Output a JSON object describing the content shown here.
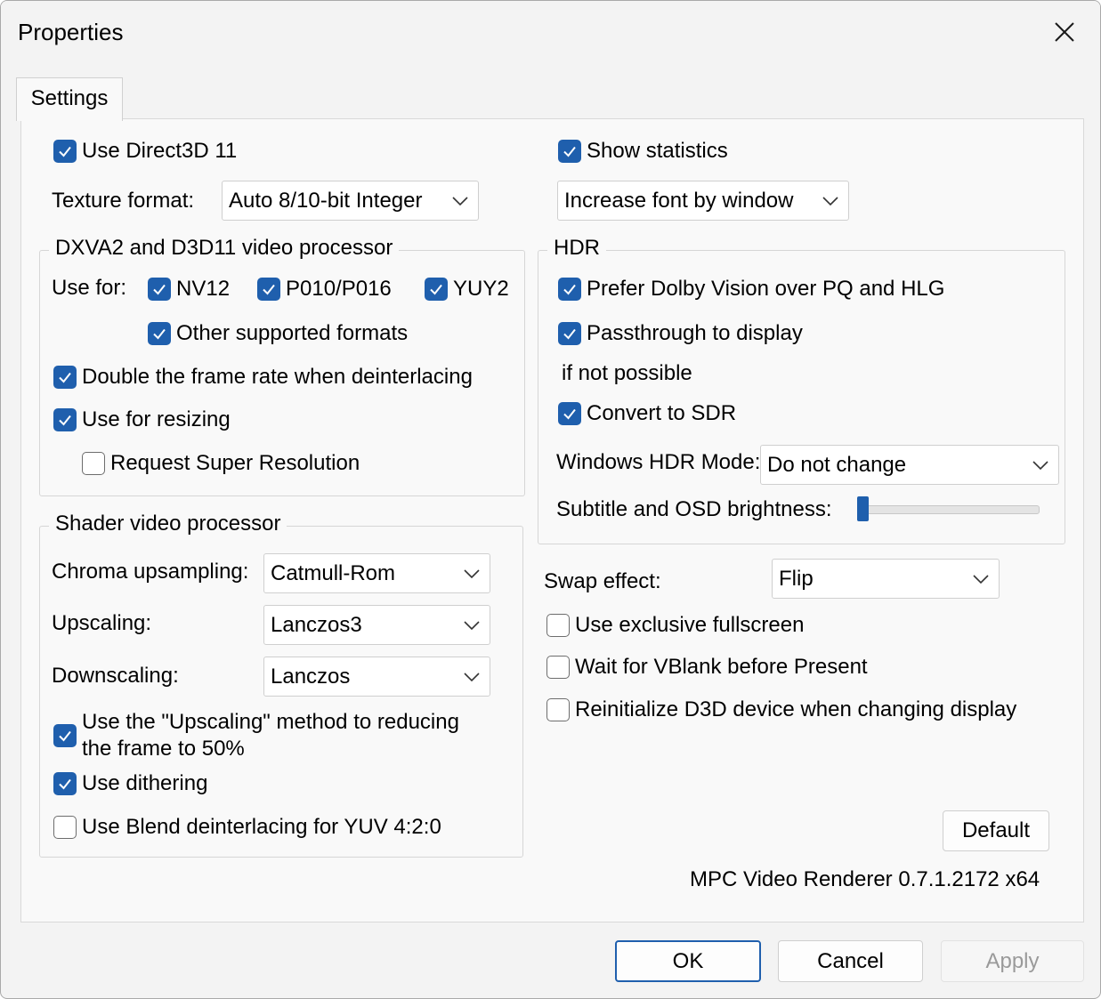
{
  "window": {
    "title": "Properties"
  },
  "tabs": [
    {
      "label": "Settings"
    }
  ],
  "left": {
    "use_d3d11": {
      "label": "Use Direct3D 11",
      "checked": true
    },
    "texture_format": {
      "label": "Texture format:",
      "value": "Auto 8/10-bit Integer"
    },
    "dxva_group": {
      "title": "DXVA2 and D3D11 video processor",
      "use_for_label": "Use for:",
      "nv12": {
        "label": "NV12",
        "checked": true
      },
      "p010": {
        "label": "P010/P016",
        "checked": true
      },
      "yuy2": {
        "label": "YUY2",
        "checked": true
      },
      "other_formats": {
        "label": "Other supported formats",
        "checked": true
      },
      "double_frame_rate": {
        "label": "Double the frame rate when deinterlacing",
        "checked": true
      },
      "use_for_resizing": {
        "label": "Use for resizing",
        "checked": true
      },
      "super_resolution": {
        "label": "Request Super Resolution",
        "checked": false
      }
    },
    "shader_group": {
      "title": "Shader video processor",
      "chroma_upsampling": {
        "label": "Chroma upsampling:",
        "value": "Catmull-Rom"
      },
      "upscaling": {
        "label": "Upscaling:",
        "value": "Lanczos3"
      },
      "downscaling": {
        "label": "Downscaling:",
        "value": "Lanczos"
      },
      "upscaling_method": {
        "line1": "Use the \"Upscaling\" method to reducing",
        "line2": "the frame to 50%",
        "checked": true
      },
      "use_dithering": {
        "label": "Use dithering",
        "checked": true
      },
      "blend_deinterlacing": {
        "label": "Use Blend deinterlacing for YUV 4:2:0",
        "checked": false
      }
    }
  },
  "right": {
    "show_statistics": {
      "label": "Show statistics",
      "checked": true
    },
    "font_mode": {
      "value": "Increase font by window"
    },
    "hdr_group": {
      "title": "HDR",
      "prefer_dolby": {
        "label": "Prefer Dolby Vision over PQ and HLG",
        "checked": true
      },
      "passthrough": {
        "label": "Passthrough to display",
        "checked": true
      },
      "if_not_possible": "if not possible",
      "convert_sdr": {
        "label": "Convert to SDR",
        "checked": true
      },
      "windows_hdr_mode": {
        "label": "Windows HDR Mode:",
        "value": "Do not change"
      },
      "subtitle_brightness": {
        "label": "Subtitle and OSD brightness:",
        "level": 0
      }
    },
    "swap_effect": {
      "label": "Swap effect:",
      "value": "Flip"
    },
    "exclusive_fullscreen": {
      "label": "Use exclusive fullscreen",
      "checked": false
    },
    "wait_vblank": {
      "label": "Wait for VBlank before Present",
      "checked": false
    },
    "reinit_d3d": {
      "label": "Reinitialize D3D device when changing display",
      "checked": false
    },
    "default_button": "Default",
    "version": "MPC Video Renderer 0.7.1.2172 x64"
  },
  "buttons": {
    "ok": "OK",
    "cancel": "Cancel",
    "apply": "Apply"
  },
  "colors": {
    "accent": "#1f5fad",
    "window_bg": "#f3f3f3",
    "panel_bg": "#f9f9f9"
  },
  "icons": {
    "close": "close-icon",
    "checkmark": "checkmark-icon",
    "dropdown": "chevron-down-icon"
  }
}
